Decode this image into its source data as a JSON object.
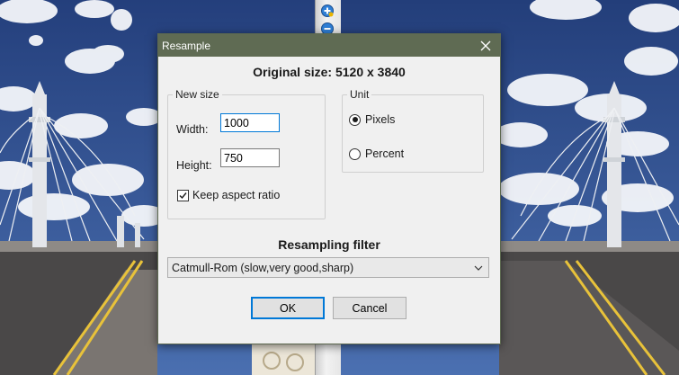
{
  "dialog": {
    "title": "Resample",
    "original_size": "Original size: 5120 x 3840",
    "new_size": {
      "group_label": "New size",
      "width_label": "Width:",
      "width_value": "1000",
      "height_label": "Height:",
      "height_value": "750",
      "keep_aspect_label": "Keep aspect ratio",
      "keep_aspect_checked": true
    },
    "unit": {
      "group_label": "Unit",
      "options": [
        "Pixels",
        "Percent"
      ],
      "selected": "Pixels"
    },
    "resampling": {
      "label": "Resampling filter",
      "selected": "Catmull-Rom (slow,very good,sharp)"
    },
    "buttons": {
      "ok": "OK",
      "cancel": "Cancel"
    }
  },
  "colors": {
    "titlebar": "#5f6b53",
    "dialog_bg": "#f0f0f0",
    "accent": "#0078d7",
    "sky": "#2f4f88"
  },
  "icons": {
    "zoom_in": "zoom-in-icon",
    "zoom_out": "zoom-out-icon",
    "close": "close-icon",
    "dropdown": "chevron-down-icon"
  }
}
